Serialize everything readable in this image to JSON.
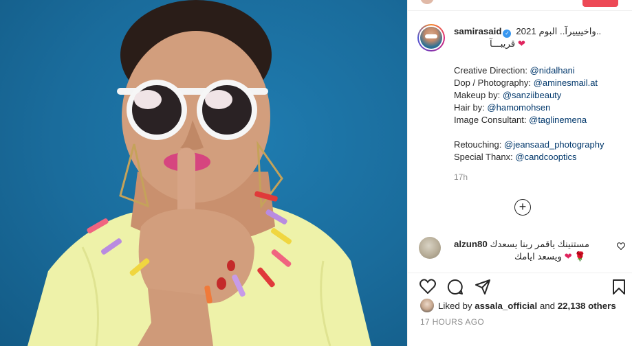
{
  "post": {
    "username": "samirasaid",
    "verified_mark": "✓",
    "caption_line1": "..واخييييرآ.. البوم 2021",
    "caption_line2": "قريبـــآ",
    "caption_emoji": "❤",
    "credits": [
      {
        "label": "Creative Direction: ",
        "handle": "@nidalhani"
      },
      {
        "label": "Dop / Photography: ",
        "handle": "@aminesmail.at"
      },
      {
        "label": "Makeup by: ",
        "handle": "@sanziibeauty"
      },
      {
        "label": "Hair by: ",
        "handle": "@hamomohsen"
      },
      {
        "label": "Image Consultant: ",
        "handle": "@taglinemena"
      },
      {
        "label": "Retouching: ",
        "handle": "@jeansaad_photography"
      },
      {
        "label": "Special Thanx: ",
        "handle": "@candcooptics"
      }
    ],
    "relative_time": "17h",
    "load_more": "+"
  },
  "comment": {
    "username": "alzun80",
    "text_line1": "مستنينك ياقمر ربنا يسعدك",
    "text_line2": "ويسعد ايامك",
    "emoji": "❤ 🌹"
  },
  "likes": {
    "prefix": "Liked by ",
    "user": "assala_official",
    "middle": " and ",
    "count": "22,138 others"
  },
  "timestamp": "17 HOURS AGO",
  "icons": {
    "like": "heart-outline-icon",
    "comment": "speech-bubble-icon",
    "share": "paper-plane-icon",
    "save": "bookmark-icon",
    "comment_like": "small-heart-icon"
  },
  "colors": {
    "photo_background": "#1a6c9c",
    "link": "#00376b",
    "verified": "#3897f0",
    "heart": "#e0245e",
    "muted": "#8e8e8e"
  }
}
